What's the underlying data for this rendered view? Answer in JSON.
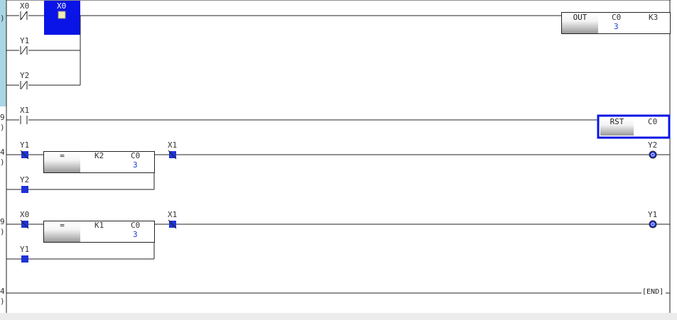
{
  "rung_numbers": {
    "r0_paren": ")",
    "r1_num": "9",
    "r1_paren": ")",
    "r2_num": "4",
    "r2_paren": ")",
    "r3_num": "9",
    "r3_paren": ")",
    "r4_num": "4",
    "r4_paren": ")"
  },
  "rung0": {
    "contact1": "X0",
    "contact_selected": "X0",
    "contact2": "Y1",
    "contact3": "Y2",
    "out_instruction": "OUT",
    "out_device": "C0",
    "out_setvalue": "K3",
    "out_current": "3"
  },
  "rung1": {
    "contact": "X1",
    "rst_instruction": "RST",
    "rst_device": "C0"
  },
  "rung2": {
    "contact1": "Y1",
    "contact2": "Y2",
    "cmp_operator": "=",
    "cmp_op1": "K2",
    "cmp_op2": "C0",
    "cmp_current": "3",
    "contact_after": "X1",
    "coil": "Y2"
  },
  "rung3": {
    "contact1": "X0",
    "contact2": "Y1",
    "cmp_operator": "=",
    "cmp_op1": "K1",
    "cmp_op2": "C0",
    "cmp_current": "3",
    "contact_after": "X1",
    "coil": "Y1"
  },
  "rung4": {
    "end_label": "END"
  },
  "colors": {
    "selection": "#0a14e6",
    "monitor_on": "#1f33d8",
    "gutter_highlight": "#a9d6e5",
    "current_value": "#1a3fd0"
  }
}
